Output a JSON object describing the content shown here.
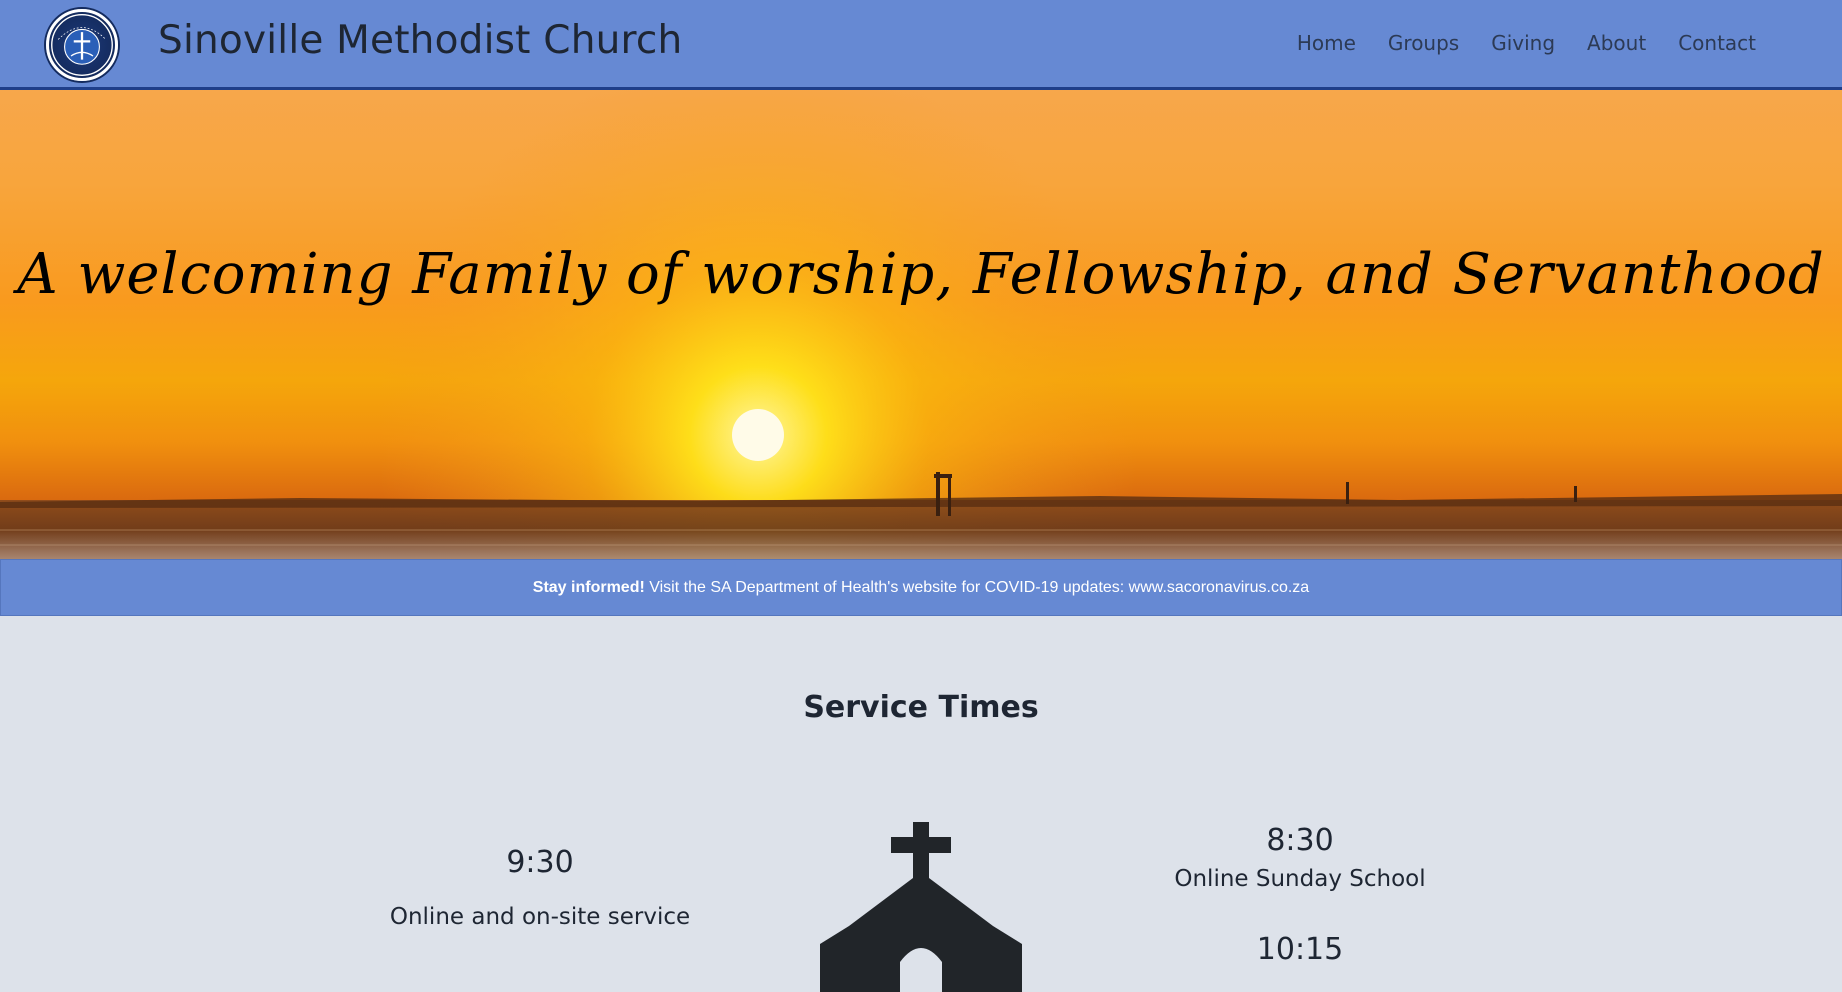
{
  "header": {
    "brand": "Sinoville Methodist Church",
    "logo_icon": "church-logo-icon",
    "nav": [
      {
        "label": "Home"
      },
      {
        "label": "Groups"
      },
      {
        "label": "Giving"
      },
      {
        "label": "About"
      },
      {
        "label": "Contact"
      }
    ]
  },
  "hero": {
    "tagline": "A welcoming Family of worship, Fellowship, and Servanthood"
  },
  "alert": {
    "strong": "Stay informed!",
    "text": " Visit the SA Department of Health's website for COVID-19 updates: www.sacoronavirus.co.za"
  },
  "services": {
    "title": "Service Times",
    "left": {
      "time": "9:30",
      "desc": "Online and on-site service"
    },
    "right": [
      {
        "time": "8:30",
        "desc": "Online Sunday School"
      },
      {
        "time": "10:15"
      }
    ],
    "icon": "church-icon"
  },
  "colors": {
    "navbar": "#6689d3",
    "page_bg": "#dde2ea",
    "text": "#1e2633"
  }
}
